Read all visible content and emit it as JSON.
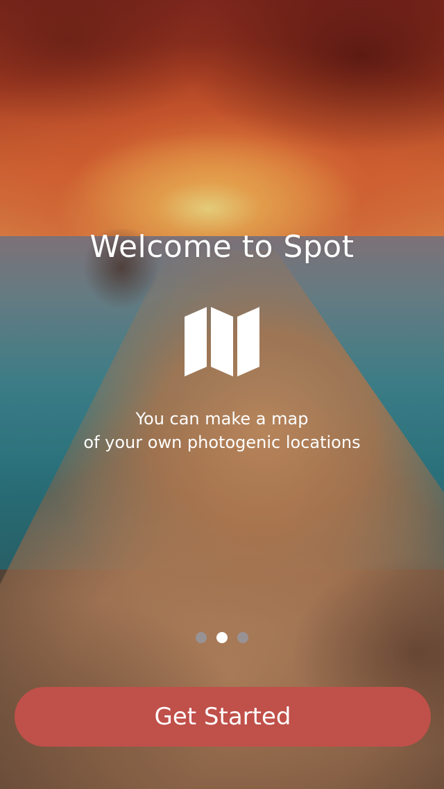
{
  "onboarding": {
    "title": "Welcome to Spot",
    "subtitle_line1": "You can make a map",
    "subtitle_line2": "of your own photogenic locations",
    "icon": "map-icon",
    "page_indicator": {
      "total_pages": 3,
      "current_page": 2
    }
  },
  "cta": {
    "label": "Get Started",
    "color": "#c0504a"
  },
  "colors": {
    "text": "#ffffff",
    "dot_inactive": "#9696a0",
    "dot_active": "#ffffff"
  }
}
